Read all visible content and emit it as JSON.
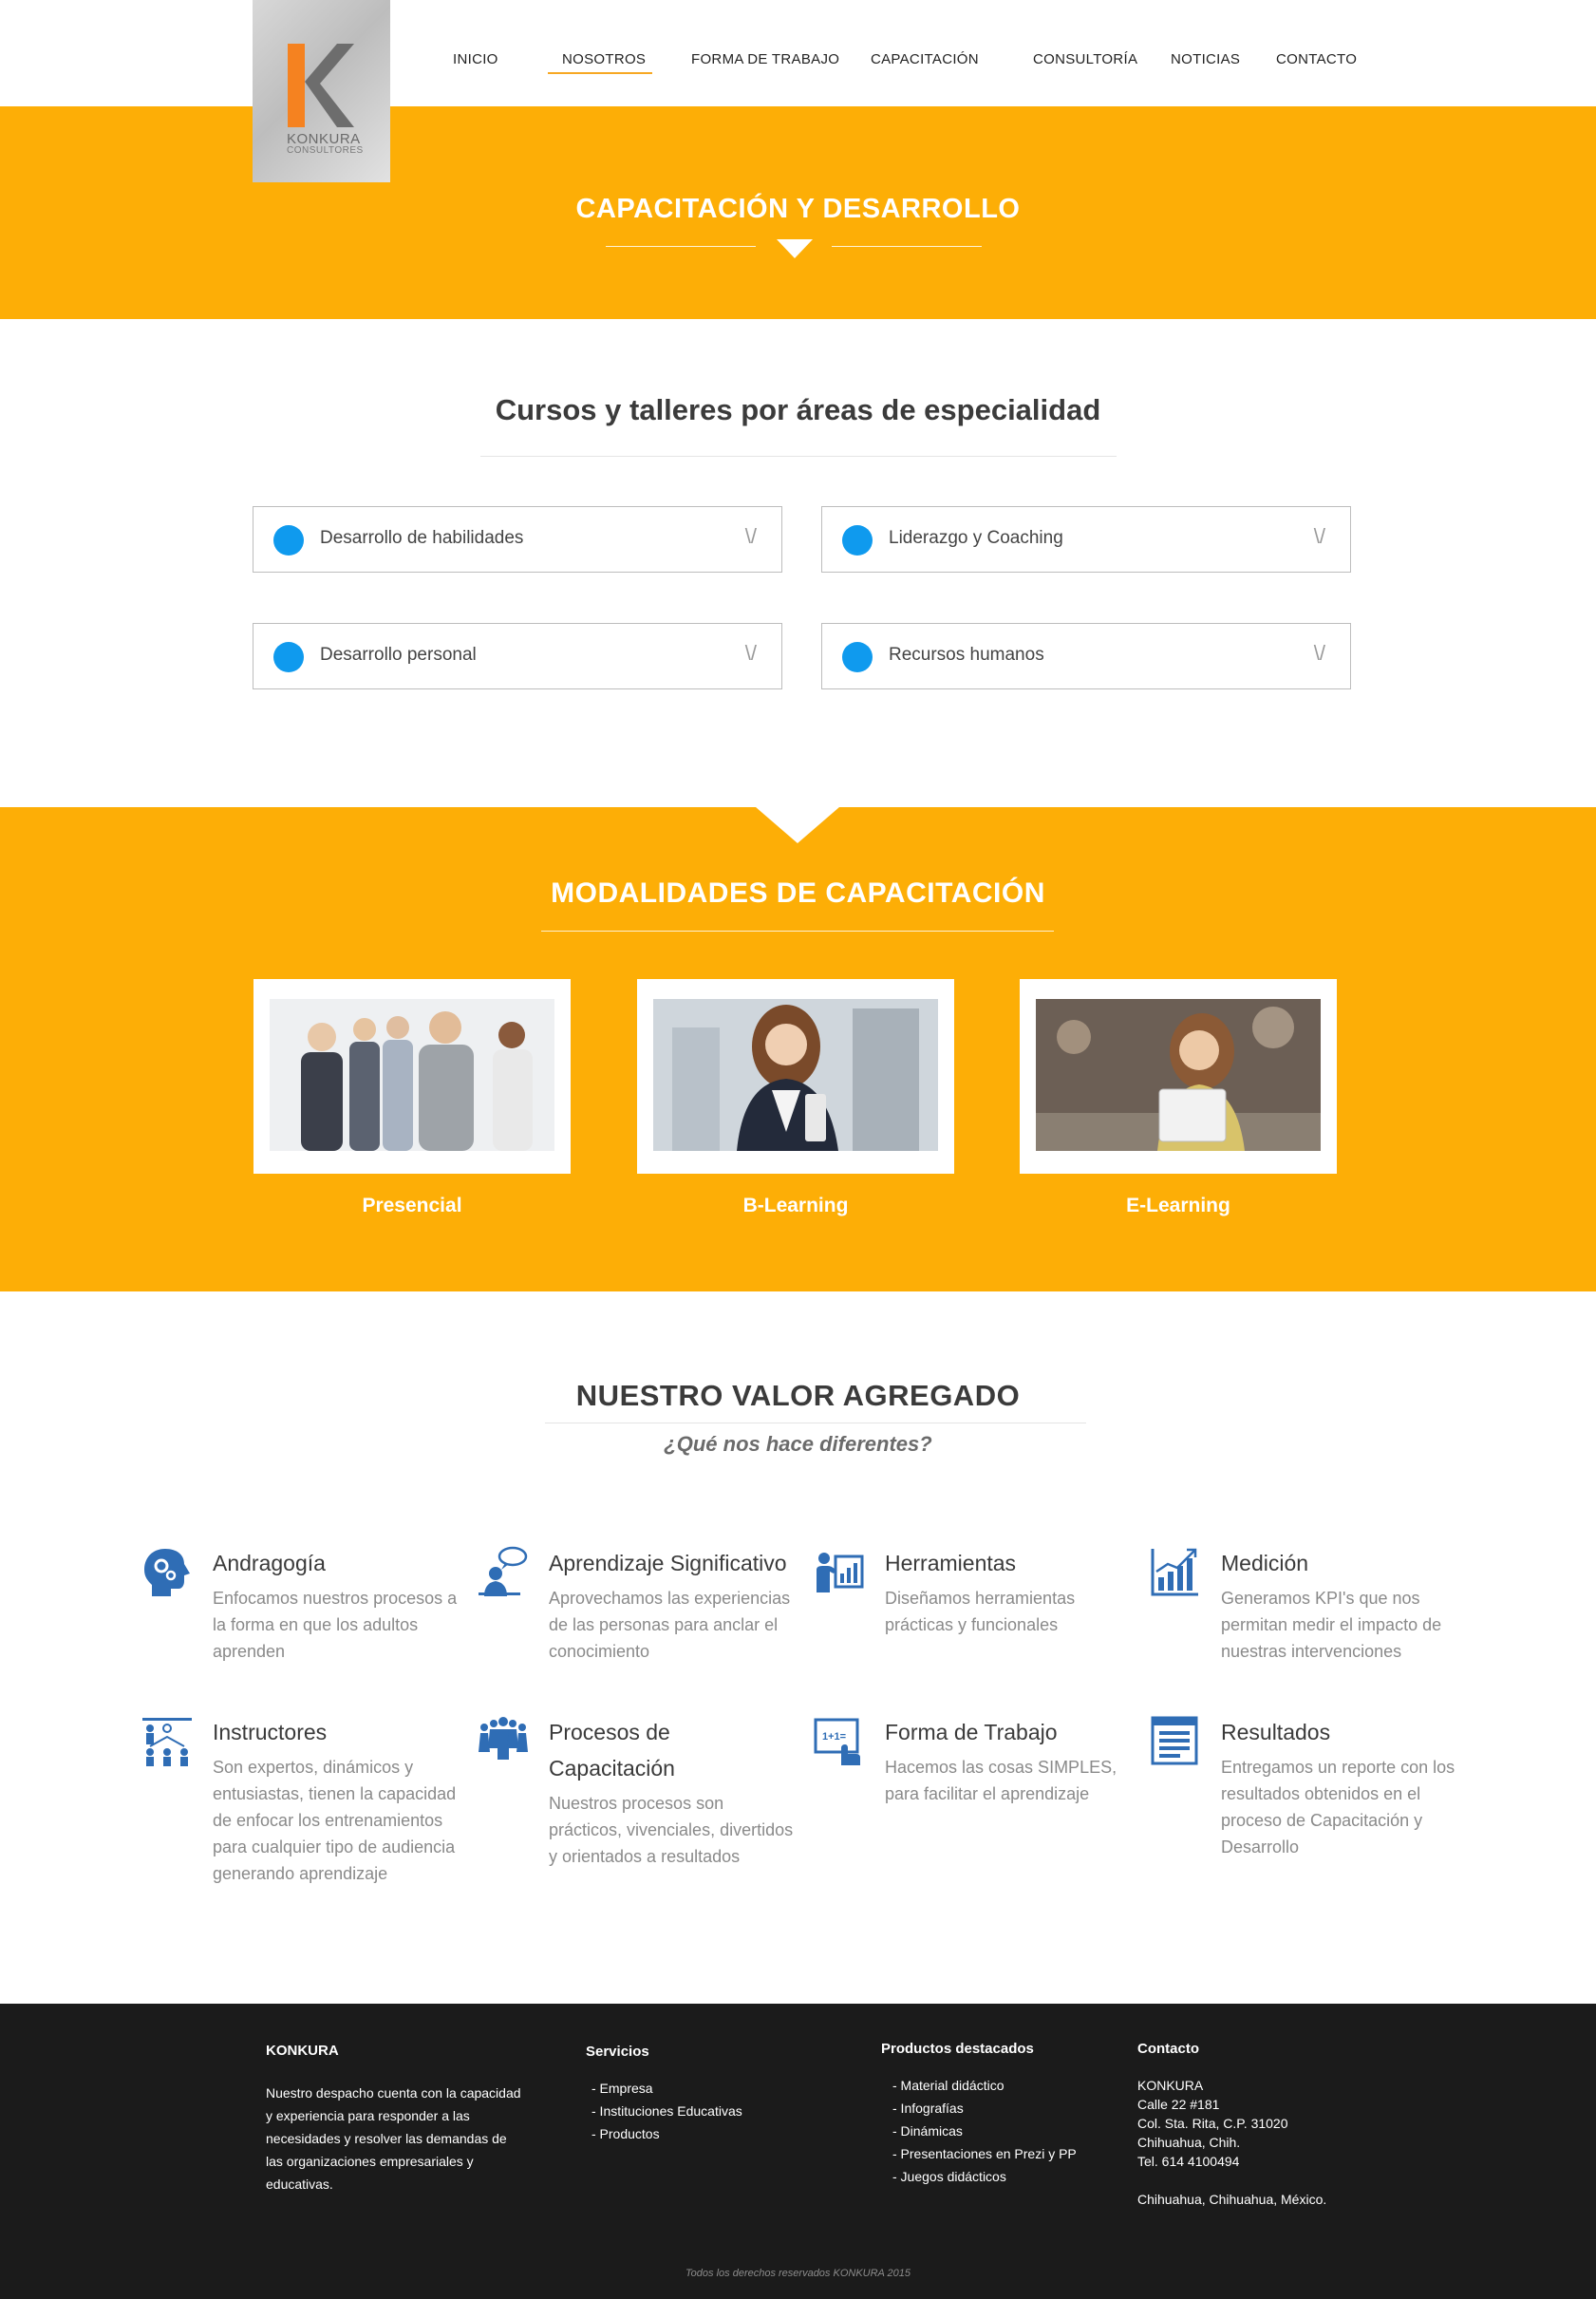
{
  "logo": {
    "brand": "KONKURA",
    "sub": "CONSULTORES"
  },
  "nav": {
    "items": [
      "INICIO",
      "NOSOTROS",
      "FORMA DE TRABAJO",
      "CAPACITACIÓN",
      "CONSULTORÍA",
      "NOTICIAS",
      "CONTACTO"
    ],
    "active": "NOSOTROS"
  },
  "hero": {
    "title": "CAPACITACIÓN Y DESARROLLO"
  },
  "courses": {
    "title": "Cursos y talleres por áreas de especialidad",
    "items": [
      {
        "label": "Desarrollo de habilidades",
        "chevron": "\\/"
      },
      {
        "label": "Liderazgo y Coaching",
        "chevron": "\\/"
      },
      {
        "label": "Desarrollo personal",
        "chevron": "\\/"
      },
      {
        "label": "Recursos humanos",
        "chevron": "\\/"
      }
    ]
  },
  "modalities": {
    "title": "MODALIDADES DE CAPACITACIÓN",
    "items": [
      {
        "label": "Presencial",
        "image": "group-of-professionals-photo"
      },
      {
        "label": "B-Learning",
        "image": "smiling-woman-with-tablet-photo"
      },
      {
        "label": "E-Learning",
        "image": "woman-thinking-with-tablet-photo"
      }
    ]
  },
  "value": {
    "title": "NUESTRO VALOR AGREGADO",
    "subtitle": "¿Qué  nos hace diferentes?",
    "features": [
      {
        "title": "Andragogía",
        "desc": "Enfocamos nuestros procesos a la forma en que los adultos aprenden",
        "icon": "head-gears-icon"
      },
      {
        "title": "Aprendizaje Significativo",
        "desc": "Aprovechamos las experiencias de las personas para anclar el conocimiento",
        "icon": "person-speech-icon"
      },
      {
        "title": "Herramientas",
        "desc": "Diseñamos herramientas prácticas y funcionales",
        "icon": "presenter-board-icon"
      },
      {
        "title": "Medición",
        "desc": "Generamos KPI's que nos permitan medir el impacto de nuestras intervenciones",
        "icon": "bar-chart-icon"
      },
      {
        "title": "Instructores",
        "desc": "Son expertos, dinámicos y entusiastas, tienen la capacidad de enfocar los entrenamientos para cualquier tipo de audiencia generando aprendizaje",
        "icon": "org-people-icon"
      },
      {
        "title": "Procesos de Capacitación",
        "desc": "Nuestros procesos son prácticos, vivenciales, divertidos y orientados a resultados",
        "icon": "group-people-icon"
      },
      {
        "title": "Forma de Trabajo",
        "desc": "Hacemos las cosas SIMPLES, para facilitar el aprendizaje",
        "icon": "board-touch-icon"
      },
      {
        "title": "Resultados",
        "desc": "Entregamos un reporte con los resultados obtenidos en el proceso de Capacitación y Desarrollo",
        "icon": "report-document-icon"
      }
    ]
  },
  "footer": {
    "about": {
      "title": "KONKURA",
      "text": "Nuestro despacho cuenta con la capacidad y experiencia  para responder a las necesidades y resolver las demandas de las organizaciones empresariales y educativas."
    },
    "services": {
      "title": "Servicios",
      "items": [
        "- Empresa",
        "-  Instituciones Educativas",
        "- Productos"
      ]
    },
    "products": {
      "title": "Productos destacados",
      "items": [
        "- Material didáctico",
        "- Infografías",
        "- Dinámicas",
        "- Presentaciones en Prezi y PP",
        "- Juegos didácticos"
      ]
    },
    "contact": {
      "title": "Contacto",
      "lines": [
        "KONKURA",
        "Calle 22 #181",
        "Col. Sta. Rita, C.P. 31020",
        "Chihuahua, Chih.",
        "Tel. 614 4100494",
        "",
        "Chihuahua, Chihuahua, México."
      ]
    },
    "copyright": "Todos los derechos reservados KONKURA 2015"
  },
  "colors": {
    "accent": "#fdae06",
    "bullet": "#0f9aee",
    "icon": "#2f6db5",
    "footer": "#1b1b1b",
    "nav_active": "#f7a823"
  }
}
